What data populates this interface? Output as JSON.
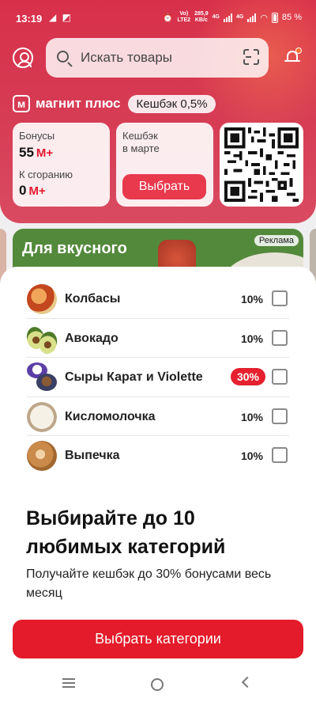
{
  "status": {
    "time": "13:19",
    "app_icons": "◢ ◩",
    "volte": "Vo)\nLTE2",
    "speed": "285,9\nKB/c",
    "net1": "4G",
    "net2": "4G",
    "battery": "85 %"
  },
  "search": {
    "placeholder": "Искать товары"
  },
  "loyalty": {
    "logo": "м",
    "name": "магнит плюс",
    "cashback": "Кешбэк 0,5%"
  },
  "cards": {
    "bonus_label": "Бонусы",
    "bonus_value": "55",
    "expire_label": "К сгоранию",
    "expire_value": "0",
    "currency": "М+",
    "cashback_label": "Кешбэк\nв марте",
    "choose_label": "Выбрать"
  },
  "banner": {
    "title": "Для вкусного",
    "ad_label": "Реклама"
  },
  "categories": [
    {
      "name": "Колбасы",
      "percent": "10%",
      "icon": "sausage"
    },
    {
      "name": "Авокадо",
      "percent": "10%",
      "icon": "avocado"
    },
    {
      "name": "Сыры Карат и Violette",
      "percent": "30%",
      "icon": "cheese",
      "highlight": true
    },
    {
      "name": "Кисломолочка",
      "percent": "10%",
      "icon": "cottage-cheese"
    },
    {
      "name": "Выпечка",
      "percent": "10%",
      "icon": "pastry"
    }
  ],
  "sheet": {
    "headline": "Выбирайте до 10 любимых категорий",
    "subline": "Получайте кешбэк до 30% бонусами весь месяц",
    "cta": "Выбрать категории"
  },
  "colors": {
    "brand_red": "#e31b2a",
    "header_gradient": "#d8304b",
    "highlight_badge": "#e5202f"
  }
}
